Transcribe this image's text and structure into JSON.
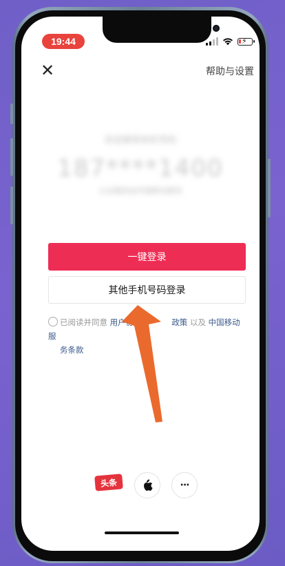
{
  "status_bar": {
    "time": "19:44"
  },
  "header": {
    "help_label": "帮助与设置"
  },
  "masked_account": {
    "label": "欢迎使用本机号码",
    "phone": "187****1400",
    "carrier": "认证服务由中国移动提供"
  },
  "buttons": {
    "one_click_login": "一键登录",
    "other_phone_login": "其他手机号码登录"
  },
  "agreement": {
    "prefix": "已阅读并同意",
    "user_agreement": "用户协议",
    "privacy_policy": "政策",
    "separator": "以及",
    "carrier_terms_1": "中国移动服",
    "carrier_terms_2": "务条款"
  },
  "social_login": {
    "toutiao_label": "头条",
    "more_label": "···"
  },
  "colors": {
    "primary": "#ee2d55",
    "link": "#3c5b8c",
    "arrow": "#ea6a2e",
    "time_pill": "#e8433c"
  }
}
